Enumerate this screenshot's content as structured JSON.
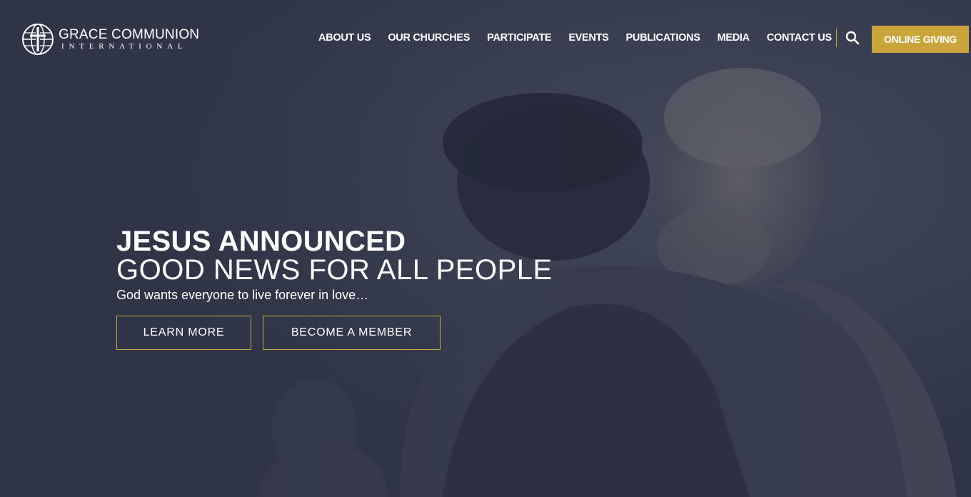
{
  "brand": {
    "name": "GRACE COMMUNION",
    "subname": "INTERNATIONAL"
  },
  "nav": {
    "items": [
      {
        "label": "ABOUT US"
      },
      {
        "label": "OUR CHURCHES"
      },
      {
        "label": "PARTICIPATE"
      },
      {
        "label": "EVENTS"
      },
      {
        "label": "PUBLICATIONS"
      },
      {
        "label": "MEDIA"
      },
      {
        "label": "CONTACT US"
      }
    ],
    "search_icon": "search-icon",
    "giving_label": "ONLINE GIVING"
  },
  "hero": {
    "headline_bold": "JESUS ANNOUNCED",
    "headline_regular": "GOOD NEWS FOR ALL PEOPLE",
    "tagline": "God wants everyone to live forever in love…",
    "buttons": {
      "learn_more": "LEARN MORE",
      "become_member": "BECOME A MEMBER"
    }
  },
  "colors": {
    "accent": "#c9a53c",
    "overlay": "#2f3447",
    "text": "#ffffff"
  }
}
